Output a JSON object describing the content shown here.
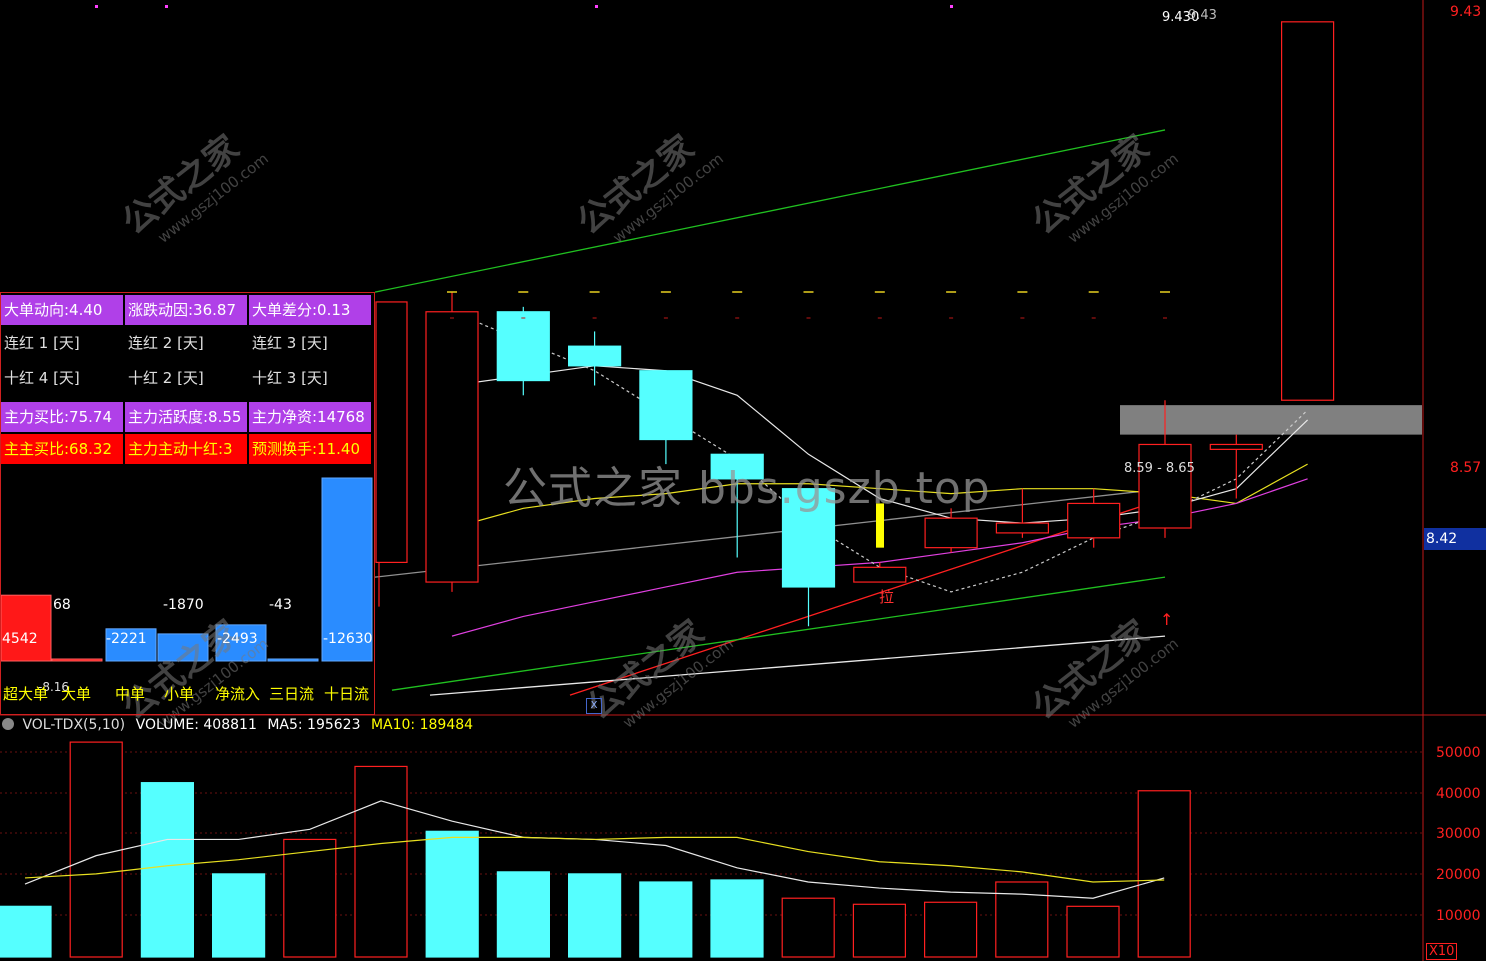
{
  "colors": {
    "bg": "#000000",
    "up": "#ff2020",
    "down": "#55ffff",
    "ma_white": "#e8e8e8",
    "ma_yellow": "#e8e020",
    "ma_magenta": "#e040e0",
    "ma_gray": "#909090",
    "trend_green": "#20c020",
    "trend_red": "#ff2020",
    "highlight_bar": "#808080"
  },
  "price_axis": {
    "ticks": [
      "9.43",
      "8.57"
    ],
    "current_price": "8.42"
  },
  "annotations": {
    "high_label": "9.430",
    "high_label_shadow": "9.43",
    "range_label": "8.59 - 8.65",
    "lala_label": "拉",
    "marker_label": "X"
  },
  "watermark": {
    "text_cn": "公式之家",
    "text_url": "www.gszj100.com",
    "center": "公式之家 bbs.gszb.top"
  },
  "info_panel": {
    "row1": [
      "大单动向:4.40",
      "涨跌动因:36.87",
      "大单差分:0.13"
    ],
    "row2": [
      "连红  1 [天]",
      "连红  2 [天]",
      "连红  3 [天]"
    ],
    "row3": [
      "十红  4 [天]",
      "十红  2 [天]",
      "十红  3 [天]"
    ],
    "row4": [
      "主力买比:75.74",
      "主力活跃度:8.55",
      "主力净资:14768"
    ],
    "row5": [
      "主主买比:68.32",
      "主力主动十红:3",
      "预测换手:11.40"
    ]
  },
  "flow_chart": {
    "type": "bar",
    "categories": [
      "超大单",
      "大单",
      "中单",
      "小单",
      "净流入",
      "三日流",
      "十日流"
    ],
    "value_labels": [
      "4542",
      "68",
      "-2221",
      "-1870",
      "-2493",
      "-43",
      "-12630"
    ],
    "extra_label": "-8.16"
  },
  "volume_panel": {
    "title": "VOL-TDX(5,10)",
    "volume_label": "VOLUME: 408811",
    "ma5_label": "MA5: 195623",
    "ma10_label": "MA10: 189484",
    "ticks": [
      "50000",
      "40000",
      "30000",
      "20000",
      "10000"
    ],
    "unit": "X10"
  },
  "chart_data": {
    "type": "candlestick",
    "candles": [
      {
        "o": 8.29,
        "h": 8.88,
        "l": 8.27,
        "c": 8.84,
        "dir": "up"
      },
      {
        "o": 8.84,
        "h": 8.85,
        "l": 8.67,
        "c": 8.7,
        "dir": "down"
      },
      {
        "o": 8.77,
        "h": 8.8,
        "l": 8.69,
        "c": 8.73,
        "dir": "down"
      },
      {
        "o": 8.72,
        "h": 8.72,
        "l": 8.53,
        "c": 8.58,
        "dir": "down"
      },
      {
        "o": 8.55,
        "h": 8.55,
        "l": 8.34,
        "c": 8.5,
        "dir": "down"
      },
      {
        "o": 8.48,
        "h": 8.48,
        "l": 8.2,
        "c": 8.28,
        "dir": "down"
      },
      {
        "o": 8.29,
        "h": 8.33,
        "l": 8.29,
        "c": 8.32,
        "dir": "up"
      },
      {
        "o": 8.36,
        "h": 8.44,
        "l": 8.35,
        "c": 8.42,
        "dir": "up"
      },
      {
        "o": 8.39,
        "h": 8.48,
        "l": 8.38,
        "c": 8.41,
        "dir": "up"
      },
      {
        "o": 8.38,
        "h": 8.48,
        "l": 8.36,
        "c": 8.45,
        "dir": "up"
      },
      {
        "o": 8.4,
        "h": 8.66,
        "l": 8.38,
        "c": 8.57,
        "dir": "up"
      },
      {
        "o": 8.57,
        "h": 8.59,
        "l": 8.46,
        "c": 8.56,
        "dir": "up"
      },
      {
        "o": 8.66,
        "h": 9.43,
        "l": 8.66,
        "c": 9.43,
        "dir": "up"
      }
    ],
    "ylim": [
      8.05,
      9.45
    ],
    "volumes": [
      12500,
      53000,
      43000,
      20500,
      29000,
      47000,
      31000,
      21000,
      20500,
      18500,
      19000,
      14500,
      13000,
      13500,
      18500,
      12500,
      41000
    ],
    "volume_dirs": [
      "down",
      "up",
      "down",
      "down",
      "up",
      "up",
      "down",
      "down",
      "down",
      "down",
      "down",
      "up",
      "up",
      "up",
      "up",
      "up",
      "up"
    ],
    "vol_ma5": [
      18000,
      25000,
      29000,
      29000,
      31500,
      38500,
      33500,
      29500,
      29000,
      27500,
      22000,
      18500,
      17000,
      16000,
      15500,
      14500,
      19500
    ],
    "vol_ma10": [
      19500,
      20500,
      22500,
      24000,
      26000,
      28000,
      29500,
      29500,
      29000,
      29500,
      29500,
      26000,
      23500,
      22500,
      21000,
      18500,
      19000
    ],
    "vol_ylim": [
      0,
      55000
    ]
  }
}
